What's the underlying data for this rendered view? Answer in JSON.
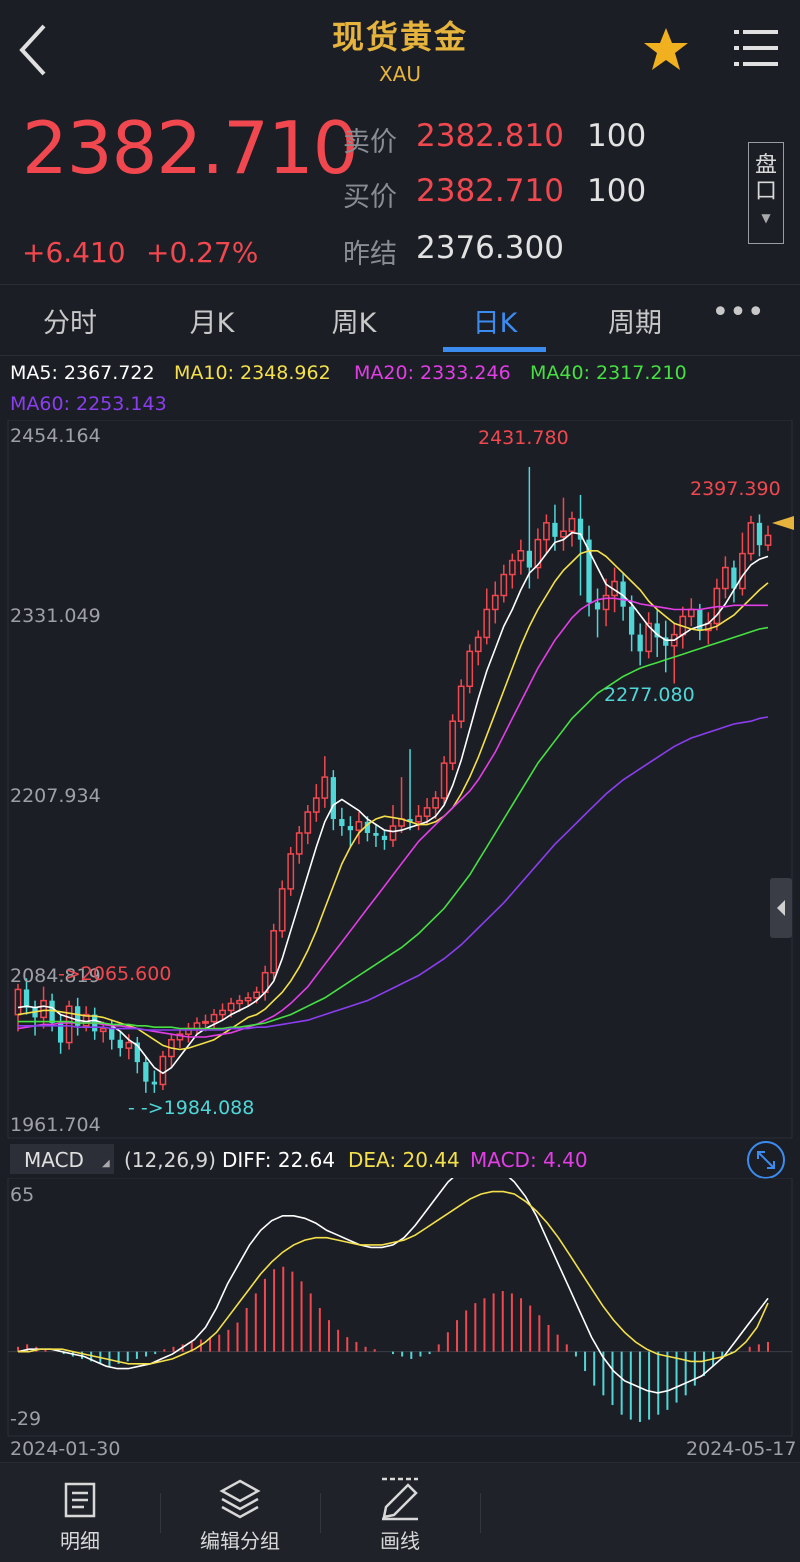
{
  "header": {
    "title": "现货黄金",
    "subtitle": "XAU"
  },
  "quote": {
    "price": "2382.710",
    "change": "+6.410",
    "change_pct": "+0.27%",
    "sell_label": "卖价",
    "sell_price": "2382.810",
    "sell_qty": "100",
    "buy_label": "买价",
    "buy_price": "2382.710",
    "buy_qty": "100",
    "prev_label": "昨结",
    "prev_close": "2376.300",
    "pankou": [
      "盘",
      "口"
    ]
  },
  "tabs": [
    {
      "label": "分时",
      "active": false
    },
    {
      "label": "月K",
      "active": false
    },
    {
      "label": "周K",
      "active": false
    },
    {
      "label": "日K",
      "active": true
    },
    {
      "label": "周期",
      "active": false
    }
  ],
  "ma": {
    "ma5": "MA5: 2367.722",
    "ma10": "MA10: 2348.962",
    "ma20": "MA20: 2333.246",
    "ma40": "MA40: 2317.210",
    "ma60": "MA60: 2253.143"
  },
  "price_axis": [
    "2454.164",
    "2331.049",
    "2207.934",
    "2084.819",
    "1961.704"
  ],
  "annotations": {
    "high": "2431.780",
    "recent_high": "2397.390",
    "low_mid": "2277.080",
    "left_high": "->2065.600",
    "left_low": "- ->1984.088"
  },
  "macd": {
    "label": "MACD",
    "params": "(12,26,9)",
    "diff": "DIFF: 22.64",
    "dea": "DEA: 20.44",
    "macd": "MACD: 4.40",
    "axis_top": "65",
    "axis_bottom": "-29"
  },
  "dates": {
    "start": "2024-01-30",
    "end": "2024-05-17"
  },
  "bottom_nav": [
    {
      "label": "明细",
      "icon": "document-icon"
    },
    {
      "label": "编辑分组",
      "icon": "layers-icon"
    },
    {
      "label": "画线",
      "icon": "pen-icon"
    }
  ],
  "colors": {
    "up": "#f0484e",
    "down": "#4fd6d6",
    "ma5": "#ffffff",
    "ma10": "#f4e04a",
    "ma20": "#e23ee6",
    "ma40": "#46e042",
    "ma60": "#8a3ef0",
    "accent": "#3c8cf0",
    "gold": "#e6b33c"
  },
  "chart_data": {
    "type": "candlestick",
    "price_range": [
      1961.704,
      2454.164
    ],
    "candles": [
      [
        2040,
        2058,
        2028,
        2062
      ],
      [
        2058,
        2045,
        2040,
        2066
      ],
      [
        2045,
        2038,
        2025,
        2050
      ],
      [
        2038,
        2050,
        2030,
        2060
      ],
      [
        2050,
        2034,
        2028,
        2055
      ],
      [
        2034,
        2020,
        2012,
        2040
      ],
      [
        2020,
        2046,
        2015,
        2050
      ],
      [
        2046,
        2032,
        2025,
        2052
      ],
      [
        2032,
        2040,
        2028,
        2046
      ],
      [
        2040,
        2028,
        2022,
        2045
      ],
      [
        2028,
        2030,
        2020,
        2035
      ],
      [
        2030,
        2022,
        2015,
        2036
      ],
      [
        2022,
        2016,
        2010,
        2028
      ],
      [
        2016,
        2020,
        2008,
        2026
      ],
      [
        2020,
        2006,
        1998,
        2024
      ],
      [
        2006,
        1992,
        1984,
        2010
      ],
      [
        1992,
        1990,
        1984,
        2000
      ],
      [
        1990,
        2010,
        1986,
        2014
      ],
      [
        2010,
        2022,
        2002,
        2026
      ],
      [
        2022,
        2026,
        2016,
        2030
      ],
      [
        2026,
        2030,
        2020,
        2034
      ],
      [
        2030,
        2034,
        2026,
        2038
      ],
      [
        2034,
        2035,
        2028,
        2040
      ],
      [
        2035,
        2040,
        2030,
        2044
      ],
      [
        2040,
        2043,
        2036,
        2048
      ],
      [
        2043,
        2048,
        2038,
        2052
      ],
      [
        2048,
        2050,
        2042,
        2054
      ],
      [
        2050,
        2052,
        2046,
        2056
      ],
      [
        2052,
        2056,
        2048,
        2060
      ],
      [
        2056,
        2070,
        2050,
        2075
      ],
      [
        2070,
        2100,
        2065,
        2105
      ],
      [
        2100,
        2130,
        2095,
        2136
      ],
      [
        2130,
        2155,
        2125,
        2160
      ],
      [
        2155,
        2170,
        2148,
        2175
      ],
      [
        2170,
        2185,
        2162,
        2190
      ],
      [
        2185,
        2195,
        2178,
        2205
      ],
      [
        2195,
        2210,
        2188,
        2225
      ],
      [
        2210,
        2180,
        2172,
        2215
      ],
      [
        2180,
        2175,
        2168,
        2188
      ],
      [
        2175,
        2172,
        2160,
        2182
      ],
      [
        2172,
        2178,
        2162,
        2185
      ],
      [
        2178,
        2170,
        2164,
        2182
      ],
      [
        2170,
        2168,
        2160,
        2176
      ],
      [
        2168,
        2165,
        2158,
        2172
      ],
      [
        2165,
        2175,
        2160,
        2190
      ],
      [
        2175,
        2180,
        2170,
        2210
      ],
      [
        2180,
        2178,
        2172,
        2230
      ],
      [
        2178,
        2182,
        2172,
        2190
      ],
      [
        2182,
        2188,
        2176,
        2195
      ],
      [
        2188,
        2195,
        2180,
        2200
      ],
      [
        2195,
        2220,
        2190,
        2225
      ],
      [
        2220,
        2250,
        2215,
        2255
      ],
      [
        2250,
        2275,
        2245,
        2280
      ],
      [
        2275,
        2300,
        2270,
        2305
      ],
      [
        2300,
        2310,
        2290,
        2315
      ],
      [
        2310,
        2330,
        2305,
        2345
      ],
      [
        2330,
        2340,
        2320,
        2350
      ],
      [
        2340,
        2355,
        2335,
        2362
      ],
      [
        2355,
        2365,
        2345,
        2370
      ],
      [
        2365,
        2372,
        2355,
        2380
      ],
      [
        2372,
        2360,
        2345,
        2432
      ],
      [
        2360,
        2380,
        2352,
        2388
      ],
      [
        2380,
        2392,
        2370,
        2398
      ],
      [
        2392,
        2382,
        2372,
        2405
      ],
      [
        2382,
        2386,
        2372,
        2410
      ],
      [
        2386,
        2395,
        2375,
        2400
      ],
      [
        2395,
        2380,
        2340,
        2412
      ],
      [
        2380,
        2335,
        2325,
        2390
      ],
      [
        2335,
        2330,
        2310,
        2345
      ],
      [
        2330,
        2340,
        2318,
        2352
      ],
      [
        2340,
        2350,
        2328,
        2360
      ],
      [
        2350,
        2332,
        2322,
        2356
      ],
      [
        2332,
        2312,
        2300,
        2340
      ],
      [
        2312,
        2300,
        2290,
        2320
      ],
      [
        2300,
        2320,
        2295,
        2328
      ],
      [
        2320,
        2310,
        2296,
        2330
      ],
      [
        2310,
        2304,
        2285,
        2322
      ],
      [
        2304,
        2312,
        2277,
        2320
      ],
      [
        2312,
        2325,
        2302,
        2332
      ],
      [
        2325,
        2330,
        2318,
        2338
      ],
      [
        2330,
        2315,
        2308,
        2334
      ],
      [
        2315,
        2320,
        2305,
        2328
      ],
      [
        2320,
        2345,
        2315,
        2352
      ],
      [
        2345,
        2360,
        2338,
        2368
      ],
      [
        2360,
        2345,
        2335,
        2365
      ],
      [
        2345,
        2370,
        2340,
        2385
      ],
      [
        2370,
        2392,
        2365,
        2397
      ],
      [
        2392,
        2376,
        2368,
        2398
      ],
      [
        2376,
        2383,
        2372,
        2390
      ]
    ],
    "ma_series": {
      "MA5": [
        2045,
        2046,
        2045,
        2046,
        2045,
        2040,
        2038,
        2036,
        2035,
        2036,
        2034,
        2032,
        2028,
        2022,
        2018,
        2010,
        2002,
        1998,
        2002,
        2010,
        2018,
        2026,
        2030,
        2033,
        2036,
        2040,
        2043,
        2046,
        2050,
        2056,
        2064,
        2080,
        2100,
        2120,
        2140,
        2160,
        2178,
        2190,
        2194,
        2190,
        2186,
        2180,
        2176,
        2172,
        2171,
        2172,
        2174,
        2176,
        2178,
        2182,
        2190,
        2204,
        2222,
        2244,
        2266,
        2286,
        2302,
        2318,
        2330,
        2344,
        2356,
        2362,
        2370,
        2378,
        2380,
        2385,
        2384,
        2372,
        2360,
        2348,
        2344,
        2340,
        2334,
        2326,
        2318,
        2312,
        2308,
        2308,
        2312,
        2316,
        2318,
        2320,
        2326,
        2334,
        2344,
        2354,
        2362,
        2366,
        2368
      ],
      "MA10": [
        2040,
        2041,
        2042,
        2043,
        2043,
        2042,
        2041,
        2040,
        2039,
        2039,
        2038,
        2036,
        2034,
        2032,
        2030,
        2026,
        2022,
        2018,
        2016,
        2015,
        2016,
        2018,
        2020,
        2022,
        2026,
        2030,
        2034,
        2038,
        2040,
        2044,
        2050,
        2056,
        2064,
        2074,
        2086,
        2100,
        2116,
        2132,
        2148,
        2160,
        2170,
        2176,
        2180,
        2182,
        2181,
        2180,
        2178,
        2176,
        2176,
        2178,
        2182,
        2188,
        2198,
        2210,
        2224,
        2240,
        2256,
        2272,
        2288,
        2304,
        2318,
        2330,
        2340,
        2350,
        2358,
        2364,
        2370,
        2372,
        2372,
        2368,
        2362,
        2356,
        2350,
        2344,
        2336,
        2330,
        2325,
        2320,
        2318,
        2316,
        2315,
        2316,
        2318,
        2322,
        2326,
        2332,
        2338,
        2344,
        2349
      ],
      "MA20": [
        2030,
        2031,
        2032,
        2033,
        2033,
        2034,
        2034,
        2034,
        2034,
        2034,
        2033,
        2032,
        2032,
        2031,
        2030,
        2029,
        2028,
        2027,
        2026,
        2025,
        2024,
        2024,
        2024,
        2025,
        2026,
        2027,
        2029,
        2031,
        2033,
        2036,
        2039,
        2043,
        2048,
        2054,
        2060,
        2068,
        2076,
        2084,
        2092,
        2100,
        2108,
        2116,
        2124,
        2132,
        2140,
        2148,
        2156,
        2164,
        2170,
        2176,
        2182,
        2188,
        2194,
        2200,
        2208,
        2218,
        2228,
        2240,
        2252,
        2264,
        2276,
        2288,
        2298,
        2308,
        2316,
        2324,
        2330,
        2334,
        2337,
        2338,
        2338,
        2337,
        2336,
        2334,
        2333,
        2332,
        2331,
        2330,
        2330,
        2330,
        2330,
        2331,
        2332,
        2332,
        2333,
        2333,
        2333,
        2333,
        2333
      ],
      "MA40": [
        2035,
        2035,
        2035,
        2035,
        2035,
        2035,
        2035,
        2034,
        2034,
        2034,
        2034,
        2033,
        2033,
        2033,
        2032,
        2032,
        2031,
        2031,
        2031,
        2030,
        2030,
        2030,
        2030,
        2030,
        2030,
        2031,
        2031,
        2032,
        2033,
        2034,
        2036,
        2038,
        2040,
        2043,
        2046,
        2049,
        2052,
        2056,
        2060,
        2064,
        2068,
        2072,
        2076,
        2080,
        2084,
        2088,
        2093,
        2098,
        2104,
        2110,
        2116,
        2124,
        2132,
        2140,
        2150,
        2160,
        2170,
        2180,
        2190,
        2200,
        2210,
        2220,
        2228,
        2236,
        2244,
        2252,
        2258,
        2264,
        2270,
        2274,
        2278,
        2282,
        2285,
        2288,
        2290,
        2292,
        2294,
        2296,
        2298,
        2300,
        2302,
        2304,
        2306,
        2308,
        2310,
        2312,
        2314,
        2316,
        2317
      ],
      "MA60": [
        2032,
        2032,
        2032,
        2032,
        2032,
        2032,
        2032,
        2031,
        2031,
        2031,
        2031,
        2030,
        2030,
        2030,
        2030,
        2029,
        2029,
        2029,
        2029,
        2029,
        2029,
        2029,
        2029,
        2029,
        2029,
        2030,
        2030,
        2030,
        2031,
        2031,
        2032,
        2033,
        2034,
        2035,
        2036,
        2038,
        2040,
        2042,
        2044,
        2046,
        2048,
        2050,
        2053,
        2056,
        2059,
        2062,
        2065,
        2068,
        2072,
        2076,
        2080,
        2085,
        2090,
        2096,
        2102,
        2108,
        2114,
        2120,
        2127,
        2134,
        2141,
        2148,
        2155,
        2162,
        2168,
        2174,
        2180,
        2186,
        2192,
        2198,
        2203,
        2208,
        2212,
        2216,
        2220,
        2224,
        2228,
        2232,
        2235,
        2238,
        2240,
        2242,
        2244,
        2246,
        2248,
        2249,
        2250,
        2252,
        2253
      ]
    },
    "macd_range": [
      -29,
      65
    ],
    "macd_hist": [
      2,
      3,
      2,
      1,
      0,
      -1,
      -2,
      -3,
      -4,
      -5,
      -6,
      -5,
      -4,
      -3,
      -2,
      -1,
      1,
      2,
      3,
      4,
      5,
      6,
      7,
      9,
      12,
      18,
      24,
      30,
      34,
      35,
      33,
      29,
      24,
      18,
      13,
      9,
      6,
      4,
      2,
      1,
      0,
      -1,
      -2,
      -3,
      -2,
      -1,
      3,
      8,
      13,
      17,
      20,
      22,
      24,
      25,
      24,
      22,
      19,
      15,
      11,
      7,
      3,
      -2,
      -8,
      -14,
      -18,
      -22,
      -26,
      -28,
      -29,
      -28,
      -26,
      -24,
      -21,
      -18,
      -14,
      -10,
      -6,
      -3,
      -1,
      0,
      2,
      3,
      4
    ],
    "macd_diff": [
      0,
      1,
      1,
      1,
      0,
      -1,
      -2,
      -4,
      -6,
      -7,
      -7,
      -6,
      -5,
      -3,
      -1,
      2,
      5,
      10,
      18,
      28,
      36,
      44,
      50,
      54,
      56,
      56,
      55,
      53,
      50,
      48,
      46,
      44,
      43,
      43,
      44,
      47,
      52,
      58,
      64,
      70,
      74,
      76,
      77,
      76,
      74,
      70,
      64,
      56,
      46,
      36,
      26,
      16,
      6,
      -2,
      -8,
      -12,
      -14,
      -16,
      -17,
      -16,
      -14,
      -12,
      -10,
      -6,
      -2,
      4,
      10,
      16,
      22
    ],
    "macd_dea": [
      0,
      0,
      1,
      1,
      1,
      0,
      -1,
      -2,
      -3,
      -4,
      -5,
      -5,
      -5,
      -4,
      -3,
      -1,
      1,
      4,
      8,
      14,
      20,
      26,
      32,
      37,
      41,
      44,
      46,
      47,
      47,
      46,
      45,
      44,
      44,
      44,
      45,
      46,
      48,
      51,
      54,
      57,
      60,
      63,
      65,
      66,
      66,
      65,
      62,
      58,
      53,
      47,
      40,
      33,
      26,
      19,
      13,
      8,
      4,
      1,
      -1,
      -2,
      -3,
      -4,
      -4,
      -3,
      -2,
      0,
      4,
      10,
      20
    ]
  }
}
